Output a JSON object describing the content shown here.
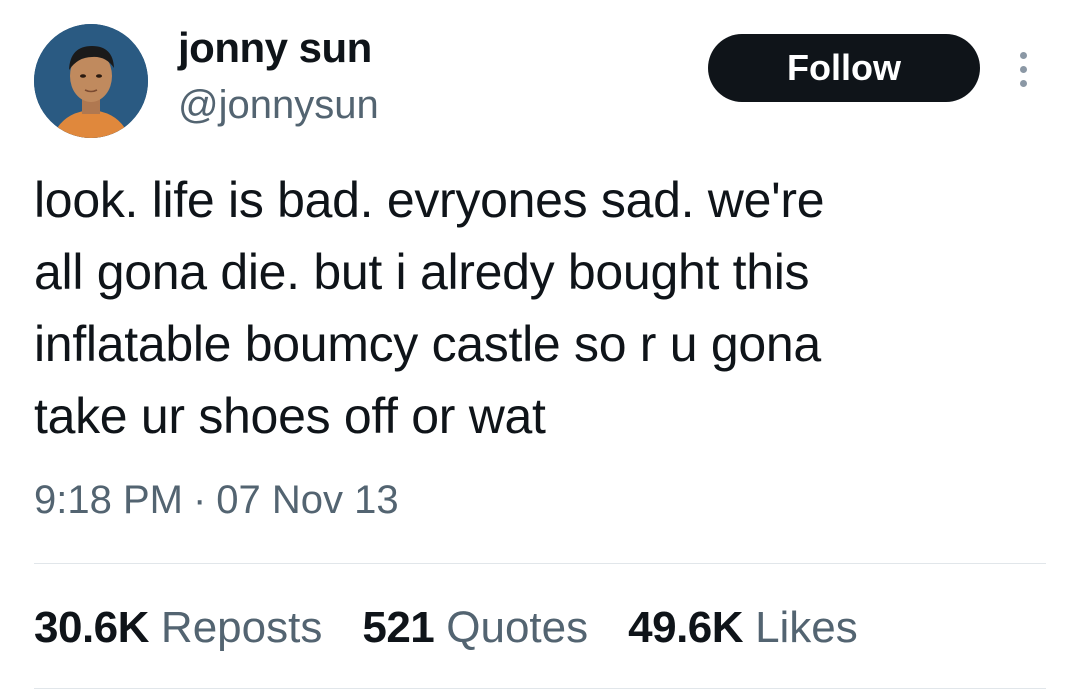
{
  "user": {
    "display_name": "jonny sun",
    "handle": "@jonnysun",
    "avatar_icon": "profile-photo"
  },
  "follow_button": {
    "label": "Follow"
  },
  "more_menu": {
    "icon": "more-vertical-icon"
  },
  "tweet": {
    "text_lines": [
      "look. life is bad. evryones sad. we're",
      "all gona die. but i alredy bought this",
      "inflatable boumcy castle so r u gona",
      "take ur shoes off or wat"
    ],
    "time": "9:18 PM",
    "separator": "·",
    "date": "07 Nov 13"
  },
  "stats": {
    "reposts": {
      "count": "30.6K",
      "label": "Reposts"
    },
    "quotes": {
      "count": "521",
      "label": "Quotes"
    },
    "likes": {
      "count": "49.6K",
      "label": "Likes"
    }
  },
  "colors": {
    "text_primary": "#0f1419",
    "text_secondary": "#536471",
    "button_bg": "#0f1419",
    "button_text": "#ffffff",
    "divider": "#e1e6ea"
  }
}
